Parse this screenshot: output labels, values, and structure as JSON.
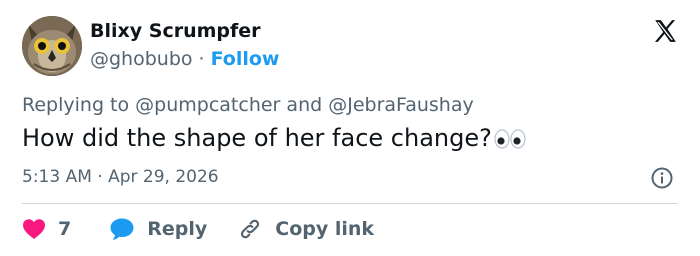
{
  "user": {
    "display_name": "Blixy Scrumpfer",
    "handle": "@ghobubo",
    "separator": "·",
    "follow_label": "Follow",
    "avatar": "owl-avatar"
  },
  "reply_context": {
    "prefix": "Replying to",
    "mention_1": "@pumpcatcher",
    "conjunction": "and",
    "mention_2": "@JebraFaushay"
  },
  "tweet": {
    "text": "How did the shape of her face change?",
    "emoji": "eyes-emoji"
  },
  "meta": {
    "time": "5:13 AM",
    "separator": "·",
    "date": "Apr 29, 2026"
  },
  "actions": {
    "like_count": "7",
    "reply_label": "Reply",
    "copy_label": "Copy link"
  },
  "icons": {
    "brand": "x-logo-icon",
    "info": "info-icon",
    "like": "heart-icon",
    "reply": "speech-bubble-icon",
    "copy": "link-icon"
  },
  "colors": {
    "accent": "#1d9bf0",
    "like": "#f91880",
    "text": "#0f1419",
    "muted": "#536471",
    "divider": "#cfd9de"
  }
}
